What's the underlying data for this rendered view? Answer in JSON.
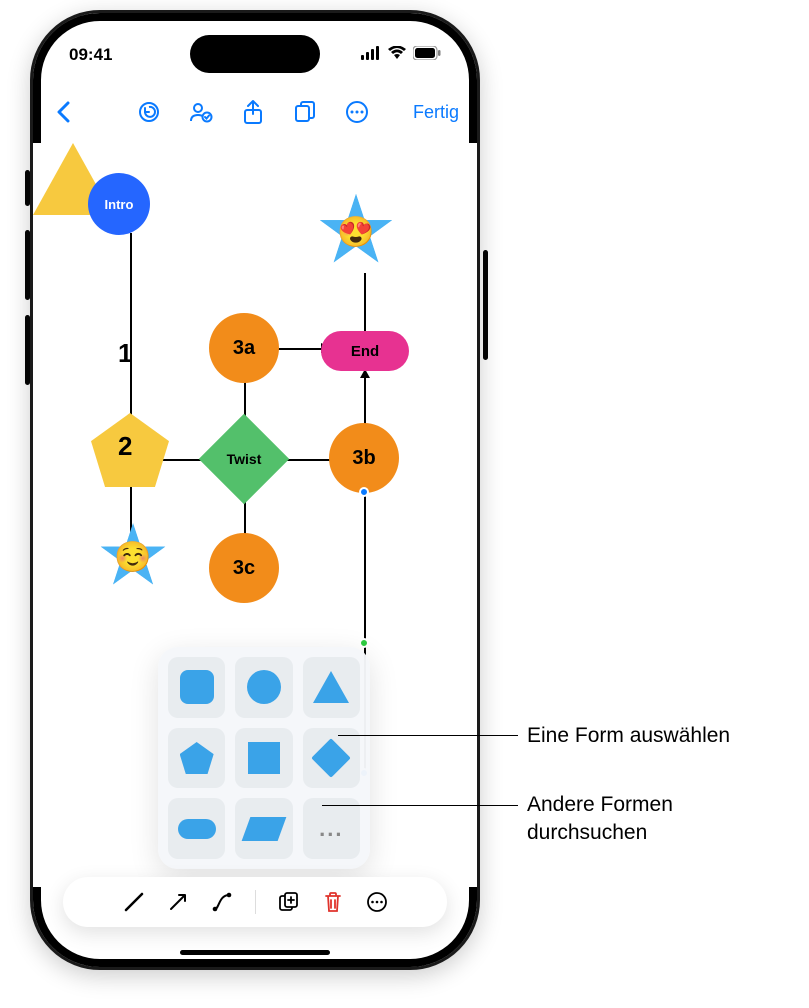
{
  "statusbar": {
    "time": "09:41"
  },
  "toolbar": {
    "done": "Fertig"
  },
  "shapes": {
    "intro": "Intro",
    "tri1": "1",
    "pent2": "2",
    "c3a": "3a",
    "c3b": "3b",
    "c3c": "3c",
    "twist": "Twist",
    "end": "End",
    "star1_emoji": "☺️",
    "star2_emoji": "😍"
  },
  "picker": {
    "more": "..."
  },
  "callouts": {
    "select_shape": "Eine Form auswählen",
    "browse_other": "Andere Formen\ndurchsuchen"
  }
}
